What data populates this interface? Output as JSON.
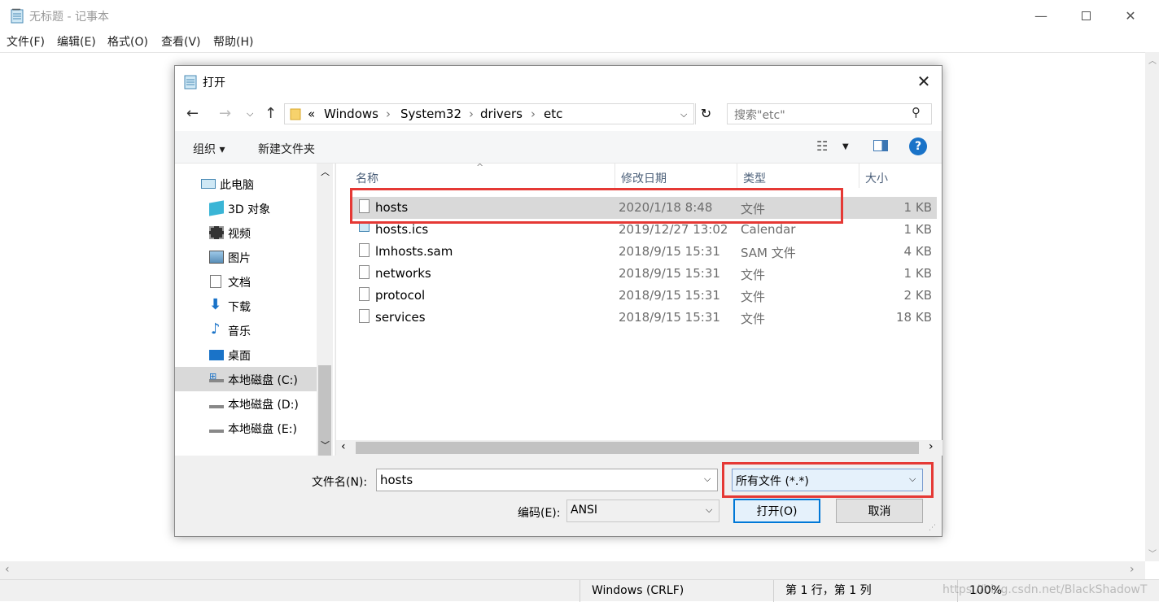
{
  "notepad": {
    "title": "无标题 - 记事本",
    "menu": [
      "文件(F)",
      "编辑(E)",
      "格式(O)",
      "查看(V)",
      "帮助(H)"
    ],
    "status": {
      "line_ending": "Windows (CRLF)",
      "position": "第 1 行，第 1 列",
      "zoom": "100%"
    },
    "watermark": "https://blog.csdn.net/BlackShadowT"
  },
  "dialog": {
    "title": "打开",
    "address": {
      "chevron": "«",
      "crumbs": [
        "Windows",
        "System32",
        "drivers",
        "etc"
      ]
    },
    "search_placeholder": "搜索\"etc\"",
    "toolbar": {
      "organize": "组织 ▾",
      "new_folder": "新建文件夹"
    },
    "sidebar": [
      {
        "label": "此电脑",
        "icon": "computer-icon"
      },
      {
        "label": "3D 对象",
        "icon": "cube-3d-icon"
      },
      {
        "label": "视频",
        "icon": "video-icon"
      },
      {
        "label": "图片",
        "icon": "picture-icon"
      },
      {
        "label": "文档",
        "icon": "document-icon"
      },
      {
        "label": "下载",
        "icon": "download-icon"
      },
      {
        "label": "音乐",
        "icon": "music-icon"
      },
      {
        "label": "桌面",
        "icon": "desktop-icon"
      },
      {
        "label": "本地磁盘 (C:)",
        "icon": "drive-icon",
        "selected": true
      },
      {
        "label": "本地磁盘 (D:)",
        "icon": "drive-icon"
      },
      {
        "label": "本地磁盘 (E:)",
        "icon": "drive-icon"
      }
    ],
    "columns": [
      "名称",
      "修改日期",
      "类型",
      "大小"
    ],
    "files": [
      {
        "name": "hosts",
        "date": "2020/1/18 8:48",
        "type": "文件",
        "size": "1 KB",
        "selected": true
      },
      {
        "name": "hosts.ics",
        "date": "2019/12/27 13:02",
        "type": "Calendar",
        "size": "1 KB"
      },
      {
        "name": "lmhosts.sam",
        "date": "2018/9/15 15:31",
        "type": "SAM 文件",
        "size": "4 KB"
      },
      {
        "name": "networks",
        "date": "2018/9/15 15:31",
        "type": "文件",
        "size": "1 KB"
      },
      {
        "name": "protocol",
        "date": "2018/9/15 15:31",
        "type": "文件",
        "size": "2 KB"
      },
      {
        "name": "services",
        "date": "2018/9/15 15:31",
        "type": "文件",
        "size": "18 KB"
      }
    ],
    "filename_label": "文件名(N):",
    "filename_value": "hosts",
    "filter_value": "所有文件  (*.*)",
    "encoding_label": "编码(E):",
    "encoding_value": "ANSI",
    "open_button": "打开(O)",
    "cancel_button": "取消"
  },
  "colors": {
    "highlight": "#e53935",
    "selected_row": "#d9d9d9",
    "help": "#1a73c8"
  }
}
